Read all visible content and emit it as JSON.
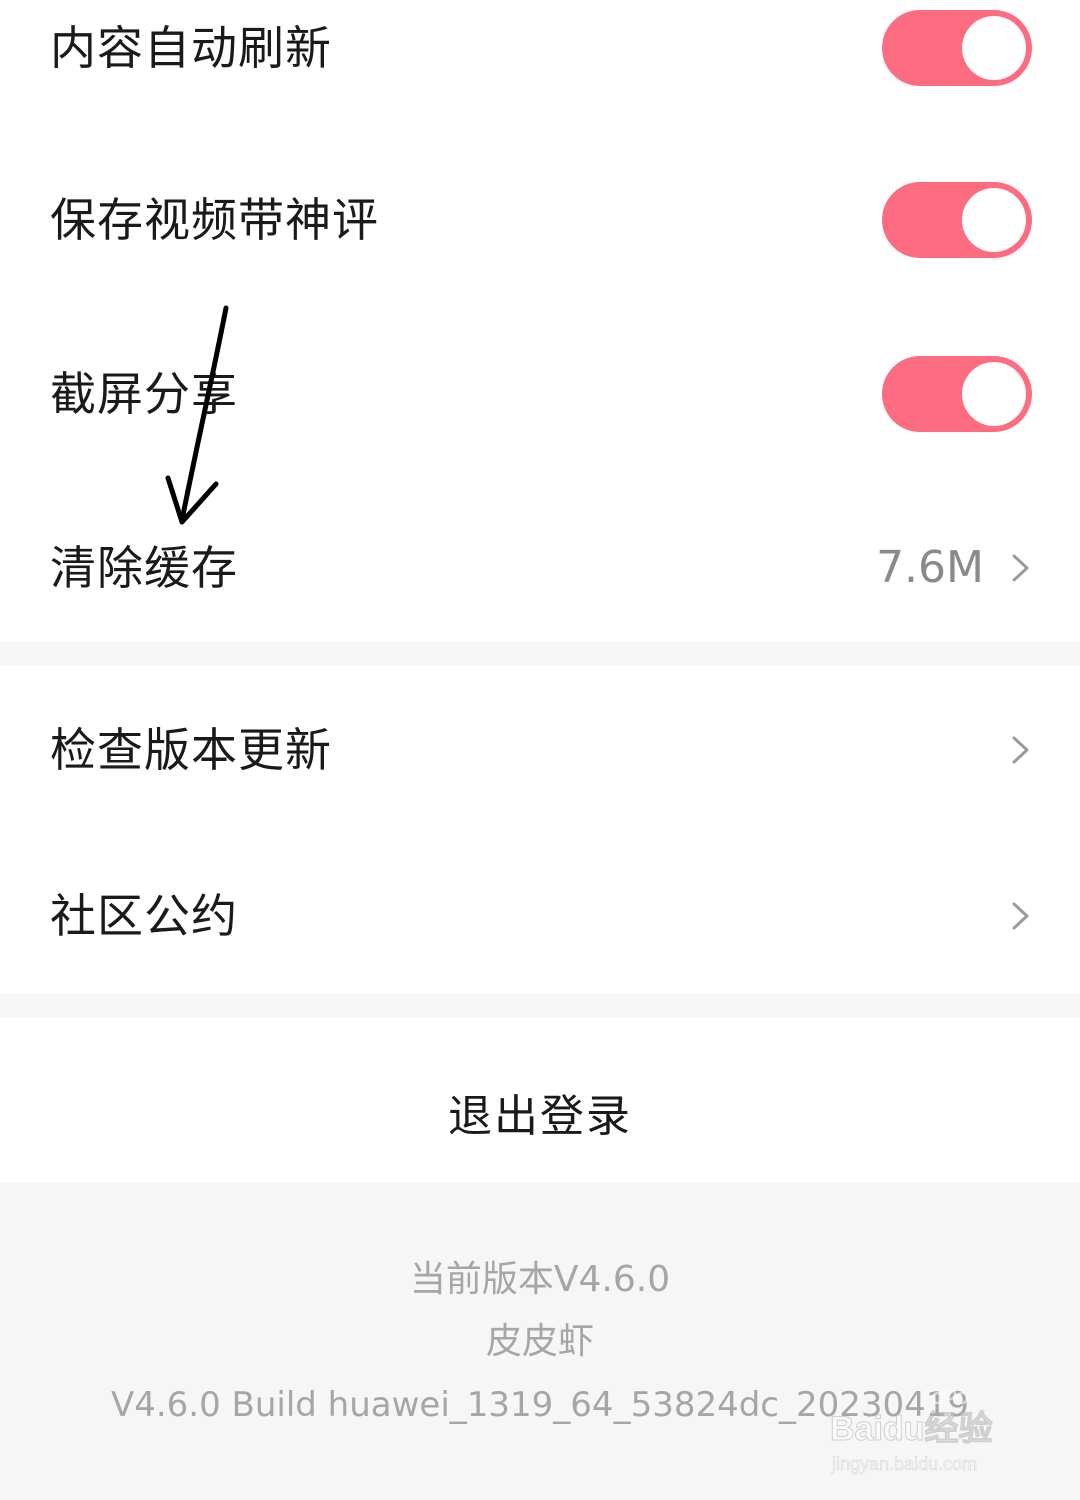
{
  "settings": {
    "rows": [
      {
        "label": "内容自动刷新",
        "toggle_on": true
      },
      {
        "label": "保存视频带神评",
        "toggle_on": true
      },
      {
        "label": "截屏分享",
        "toggle_on": true
      },
      {
        "label": "清除缓存",
        "value": "7.6M"
      }
    ],
    "links": [
      {
        "label": "检查版本更新"
      },
      {
        "label": "社区公约"
      }
    ]
  },
  "logout_label": "退出登录",
  "footer": {
    "current_version": "当前版本V4.6.0",
    "app_name": "皮皮虾",
    "build": "V4.6.0 Build huawei_1319_64_53824dc_20230419"
  },
  "watermark": {
    "brand": "Baidu经验",
    "url": "jingyan.baidu.com"
  },
  "colors": {
    "toggle_on": "#fd6c80",
    "page_background": "#f6f6f6",
    "card_background": "#ffffff"
  }
}
